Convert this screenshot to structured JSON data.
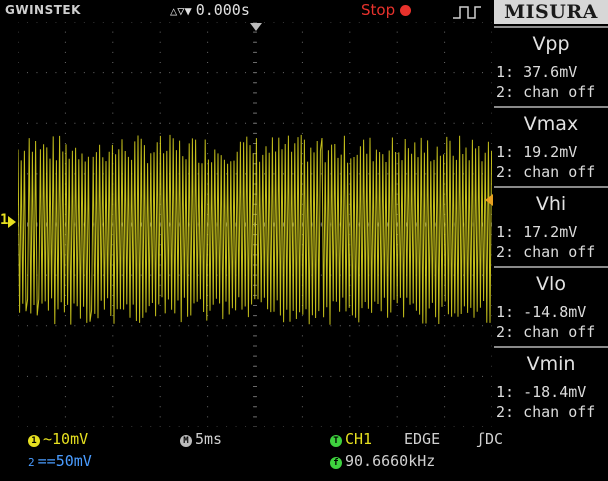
{
  "brand": "GWINSTEK",
  "header": {
    "trigger_position": "0.000s",
    "run_state": "Stop",
    "panel_title": "MISURA"
  },
  "measurements": [
    {
      "name": "Vpp",
      "ch1": "1: 37.6mV",
      "ch2": "2: chan off"
    },
    {
      "name": "Vmax",
      "ch1": "1: 19.2mV",
      "ch2": "2: chan off"
    },
    {
      "name": "Vhi",
      "ch1": "1: 17.2mV",
      "ch2": "2: chan off"
    },
    {
      "name": "Vlo",
      "ch1": "1: -14.8mV",
      "ch2": "2: chan off"
    },
    {
      "name": "Vmin",
      "ch1": "1: -18.4mV",
      "ch2": "2: chan off"
    }
  ],
  "screen": {
    "ch1_marker": "1",
    "trace_color": "#e6e020",
    "grid_color": "#6a6a6a",
    "waveform": {
      "ch1_peak_mV": 19.2,
      "ch1_trough_mV": -18.4,
      "noise": "high-frequency ripple"
    }
  },
  "bottom": {
    "ch1_badge": "1",
    "ch1_coupling": "~",
    "ch1_scale": "10mV",
    "ch2_badge": "2",
    "ch2_coupling": "==",
    "ch2_scale": "50mV",
    "timebase_badge": "M",
    "timebase": "5ms",
    "trigger_badge": "T",
    "trigger_source": "CH1",
    "trigger_type": "EDGE",
    "trigger_slope": "ʃ",
    "trigger_coupling": "DC",
    "freq_badge": "f",
    "frequency": "90.6660kHz"
  },
  "colors": {
    "ch1": "#e6e020",
    "ch2": "#4a9cff",
    "trigger": "#3ed23e",
    "stop": "#e8322c"
  }
}
